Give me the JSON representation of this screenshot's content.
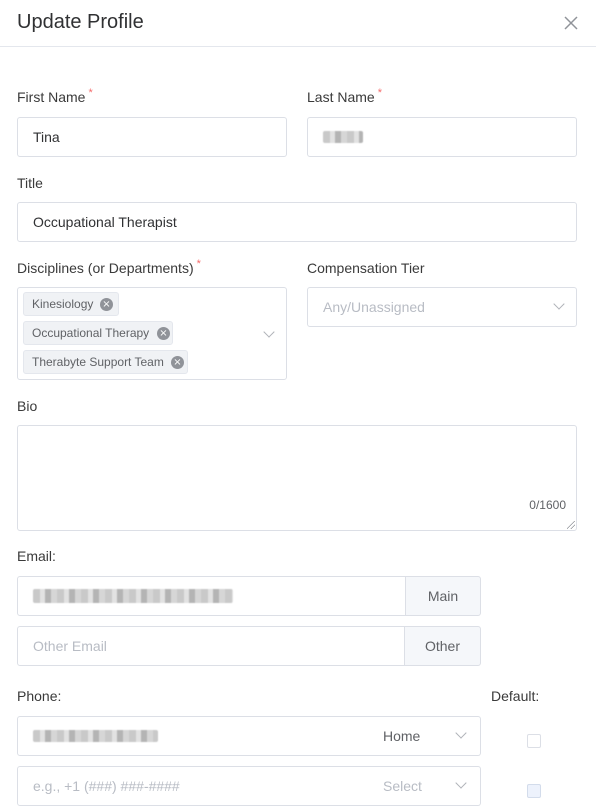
{
  "dialog": {
    "title": "Update Profile"
  },
  "form": {
    "required_mark": "*",
    "first_name": {
      "label": "First Name",
      "value": "Tina"
    },
    "last_name": {
      "label": "Last Name",
      "value": ""
    },
    "title": {
      "label": "Title",
      "value": "Occupational Therapist"
    },
    "disciplines": {
      "label": "Disciplines (or Departments)",
      "tags": [
        "Kinesiology",
        "Occupational Therapy",
        "Therabyte Support Team"
      ],
      "tag_close_glyph": "×"
    },
    "compensation": {
      "label": "Compensation Tier",
      "placeholder": "Any/Unassigned"
    },
    "bio": {
      "label": "Bio",
      "value": "",
      "counter": "0/1600"
    },
    "email": {
      "label": "Email:",
      "main_value": "",
      "main_addon": "Main",
      "other_placeholder": "Other Email",
      "other_addon": "Other"
    },
    "phone": {
      "label": "Phone:",
      "default_label": "Default:",
      "rows": [
        {
          "value": "",
          "type": "Home",
          "default_checked": false,
          "default_disabled": false
        },
        {
          "placeholder": "e.g., +1 (###) ###-####",
          "type": "Select",
          "default_checked": false,
          "default_disabled": true
        }
      ]
    }
  },
  "colors": {
    "required": "#f56c6c",
    "border": "#dcdfe6",
    "addon_bg": "#f5f7fa",
    "placeholder": "#b8bcc4"
  }
}
